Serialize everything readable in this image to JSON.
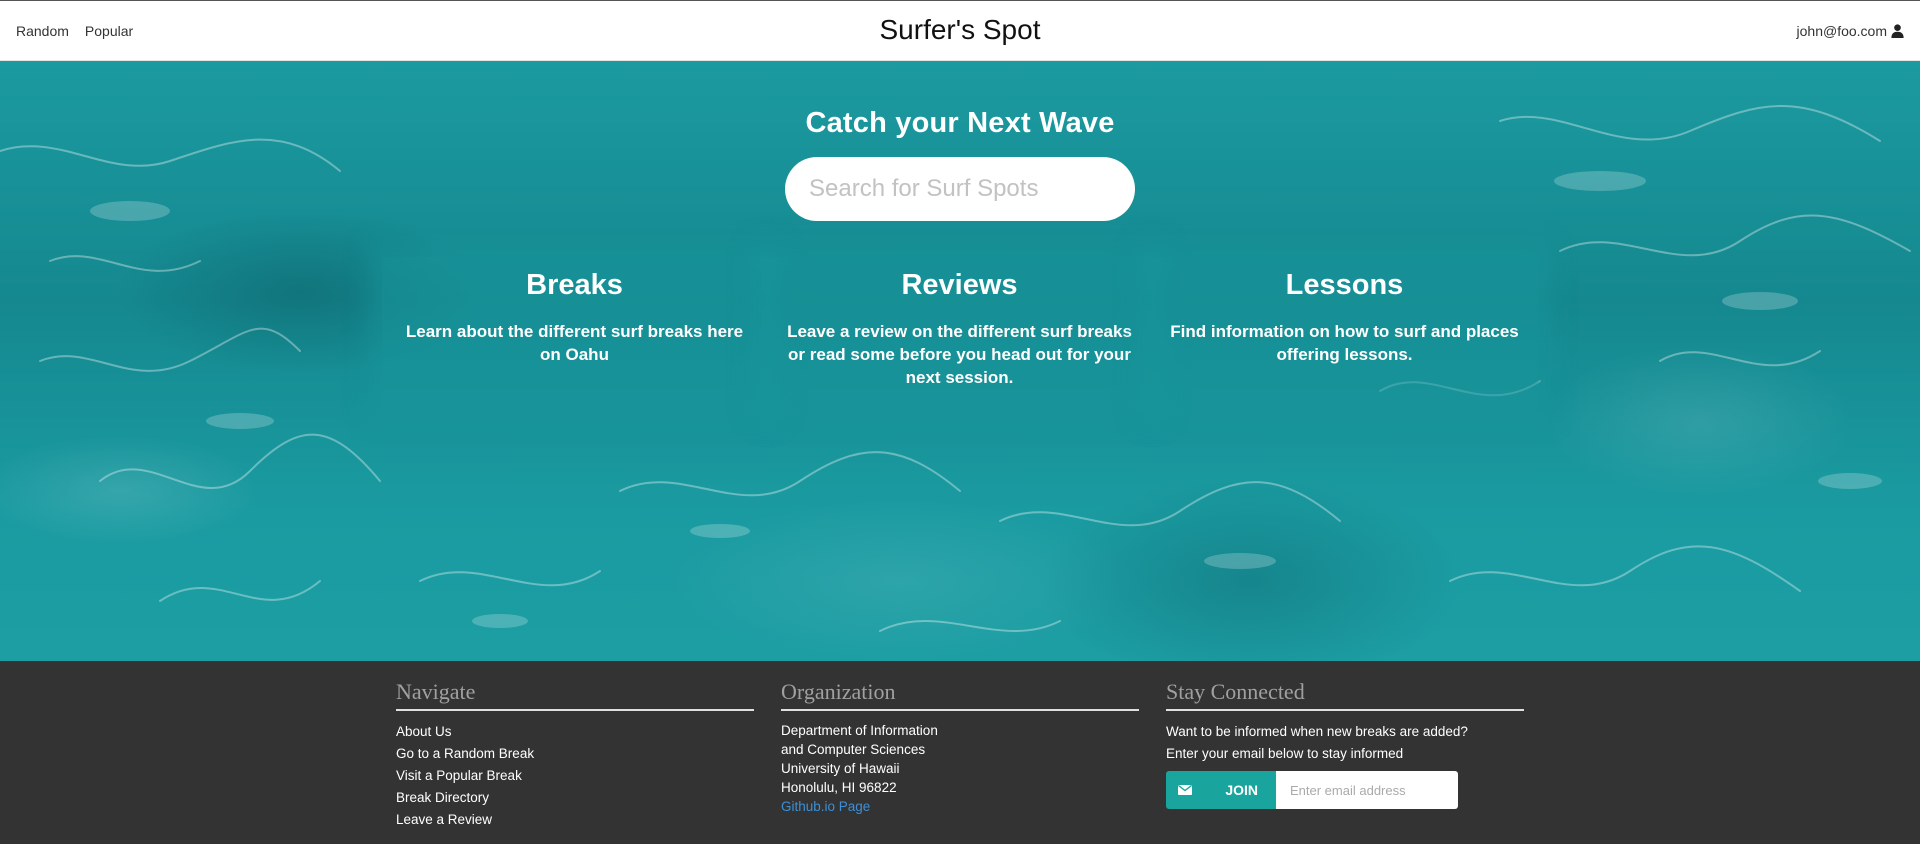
{
  "nav": {
    "links": [
      "Random",
      "Popular"
    ],
    "brand": "Surfer's Spot",
    "user_email": "john@foo.com",
    "user_icon": "user-icon"
  },
  "hero": {
    "title": "Catch your Next Wave",
    "search": {
      "placeholder": "Search for Surf Spots",
      "icon": "search-icon"
    },
    "features": [
      {
        "title": "Breaks",
        "text": "Learn about the different surf breaks here on Oahu"
      },
      {
        "title": "Reviews",
        "text": "Leave a review on the different surf breaks or read some before you head out for your next session."
      },
      {
        "title": "Lessons",
        "text": "Find information on how to surf and places offering lessons."
      }
    ]
  },
  "footer": {
    "navigate": {
      "heading": "Navigate",
      "links": [
        "About Us",
        "Go to a Random Break",
        "Visit a Popular Break",
        "Break Directory",
        "Leave a Review"
      ]
    },
    "organization": {
      "heading": "Organization",
      "lines": [
        "Department of Information",
        "and Computer Sciences",
        "University of Hawaii",
        "Honolulu, HI 96822"
      ],
      "link": "Github.io Page"
    },
    "stay_connected": {
      "heading": "Stay Connected",
      "lines": [
        "Want to be informed when new breaks are added?",
        "Enter your email below to stay informed"
      ],
      "join_label": "JOIN",
      "join_icon": "envelope-icon",
      "email_placeholder": "Enter email address"
    }
  },
  "colors": {
    "hero_water": "#18969b",
    "footer_bg": "#333333",
    "join_button": "#1aa49e",
    "footer_heading": "#a0a0a0",
    "footer_link": "#3d8fd6"
  }
}
